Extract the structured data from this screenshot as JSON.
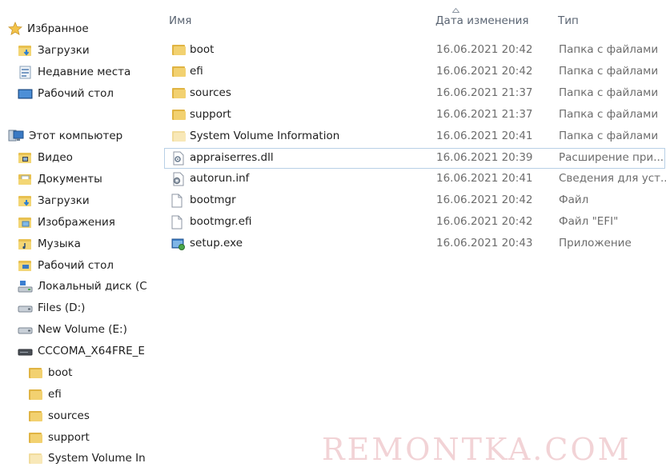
{
  "navigation": {
    "favorites": {
      "label": "Избранное",
      "items": [
        {
          "label": "Загрузки",
          "icon": "downloads-icon"
        },
        {
          "label": "Недавние места",
          "icon": "recent-places-icon"
        },
        {
          "label": "Рабочий стол",
          "icon": "desktop-icon"
        }
      ]
    },
    "computer": {
      "label": "Этот компьютер",
      "items": [
        {
          "label": "Видео",
          "icon": "videos-icon"
        },
        {
          "label": "Документы",
          "icon": "documents-icon"
        },
        {
          "label": "Загрузки",
          "icon": "downloads-icon"
        },
        {
          "label": "Изображения",
          "icon": "pictures-icon"
        },
        {
          "label": "Музыка",
          "icon": "music-icon"
        },
        {
          "label": "Рабочий стол",
          "icon": "desktop-icon"
        },
        {
          "label": "Локальный диск (C",
          "icon": "local-disk-icon"
        },
        {
          "label": "Files (D:)",
          "icon": "drive-icon"
        },
        {
          "label": "New Volume (E:)",
          "icon": "drive-icon"
        },
        {
          "label": "CCCOMA_X64FRE_E",
          "icon": "dvd-drive-icon"
        }
      ]
    },
    "drive_children": [
      {
        "label": "boot"
      },
      {
        "label": "efi"
      },
      {
        "label": "sources"
      },
      {
        "label": "support"
      },
      {
        "label": "System Volume In"
      }
    ]
  },
  "columns": {
    "name": "Имя",
    "date": "Дата изменения",
    "type": "Тип"
  },
  "files": [
    {
      "name": "boot",
      "date": "16.06.2021 20:42",
      "type": "Папка с файлами",
      "icon": "folder-icon"
    },
    {
      "name": "efi",
      "date": "16.06.2021 20:42",
      "type": "Папка с файлами",
      "icon": "folder-icon"
    },
    {
      "name": "sources",
      "date": "16.06.2021 21:37",
      "type": "Папка с файлами",
      "icon": "folder-icon"
    },
    {
      "name": "support",
      "date": "16.06.2021 21:37",
      "type": "Папка с файлами",
      "icon": "folder-icon"
    },
    {
      "name": "System Volume Information",
      "date": "16.06.2021 20:41",
      "type": "Папка с файлами",
      "icon": "folder-hidden-icon"
    },
    {
      "name": "appraiserres.dll",
      "date": "16.06.2021 20:39",
      "type": "Расширение при...",
      "icon": "dll-file-icon",
      "selected": true
    },
    {
      "name": "autorun.inf",
      "date": "16.06.2021 20:41",
      "type": "Сведения для уст...",
      "icon": "inf-file-icon"
    },
    {
      "name": "bootmgr",
      "date": "16.06.2021 20:42",
      "type": "Файл",
      "icon": "file-icon"
    },
    {
      "name": "bootmgr.efi",
      "date": "16.06.2021 20:42",
      "type": "Файл \"EFI\"",
      "icon": "file-icon"
    },
    {
      "name": "setup.exe",
      "date": "16.06.2021 20:43",
      "type": "Приложение",
      "icon": "setup-exe-icon"
    }
  ],
  "watermark": "REMONTKA.COM",
  "colors": {
    "folder": "#e8c152",
    "selection_border": "#b8d0e6",
    "header_text": "#5a6472",
    "meta_text": "#6d6d6d"
  }
}
